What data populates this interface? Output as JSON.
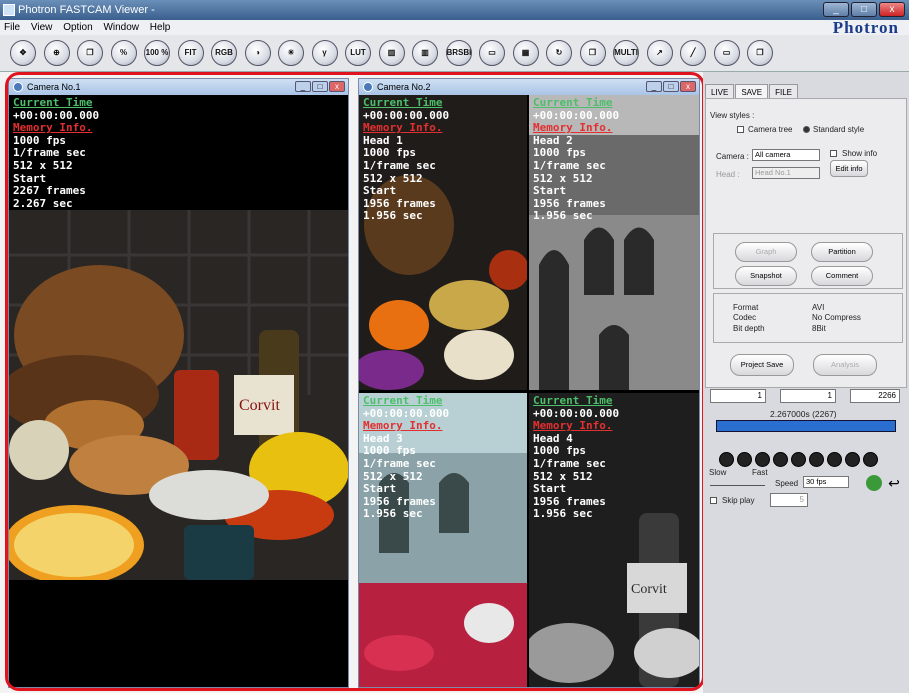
{
  "window": {
    "title": "Photron FASTCAM Viewer -",
    "brand": "Photron"
  },
  "menu": [
    "File",
    "View",
    "Option",
    "Window",
    "Help"
  ],
  "toolbar": {
    "buttons": [
      "✥",
      "⊕",
      "❐",
      "%",
      "100\n%",
      "FIT",
      "RGB",
      "◑",
      "☀",
      "γ Gamma",
      "LUT RESET",
      "▥",
      "▥",
      "BRSBR",
      "▭",
      "▦",
      "↻",
      "❐",
      "MULTI LOCK",
      "↗",
      "╱",
      "▭",
      "❐"
    ]
  },
  "camera1": {
    "title": "Camera No.1",
    "overlay": [
      "Current Time",
      "+00:00:00.000",
      "Memory Info.",
      "1000 fps",
      "1/frame sec",
      "512 x 512",
      "Start",
      "2267 frames",
      "2.267 sec"
    ]
  },
  "camera2": {
    "title": "Camera No.2",
    "heads": [
      {
        "overlay": [
          "Current Time",
          "+00:00:00.000",
          "Memory Info.",
          "Head 1",
          "1000 fps",
          "1/frame sec",
          "512 x 512",
          "Start",
          "1956 frames",
          "1.956 sec"
        ]
      },
      {
        "overlay": [
          "Current Time",
          "+00:00:00.000",
          "Memory Info.",
          "Head 2",
          "1000 fps",
          "1/frame sec",
          "512 x 512",
          "Start",
          "1956 frames",
          "1.956 sec"
        ]
      },
      {
        "overlay": [
          "Current Time",
          "+00:00:00.000",
          "Memory Info.",
          "Head 3",
          "1000 fps",
          "1/frame sec",
          "512 x 512",
          "Start",
          "1956 frames",
          "1.956 sec"
        ]
      },
      {
        "overlay": [
          "Current Time",
          "+00:00:00.000",
          "Memory Info.",
          "Head 4",
          "1000 fps",
          "1/frame sec",
          "512 x 512",
          "Start",
          "1956 frames",
          "1.956 sec"
        ]
      }
    ]
  },
  "panel": {
    "tabs": [
      "LIVE",
      "SAVE",
      "FILE"
    ],
    "view_styles_label": "View styles :",
    "camera_tree": "Camera tree",
    "standard_style": "Standard style",
    "camera_label": "Camera :",
    "camera_value": "All camera",
    "show_info": "Show info",
    "head_label": "Head :",
    "head_value": "Head No.1",
    "edit_info": "Edit info",
    "graph": "Graph",
    "partition": "Partition",
    "snapshot": "Snapshot",
    "comment": "Comment",
    "format_label": "Format",
    "format_value": "AVI",
    "codec_label": "Codec",
    "codec_value": "No Compress",
    "bitdepth_label": "Bit depth",
    "bitdepth_value": "8Bit",
    "project_save": "Project Save",
    "analysis": "Analysis"
  },
  "playback": {
    "start_frame": "1",
    "current_frame": "1",
    "end_frame": "2266",
    "time_readout": "2.267000s (2267)",
    "slow": "Slow",
    "fast": "Fast",
    "speed_label": "Speed",
    "speed_value": "30 fps",
    "skip_play": "Skip play",
    "skip_value": "5"
  }
}
